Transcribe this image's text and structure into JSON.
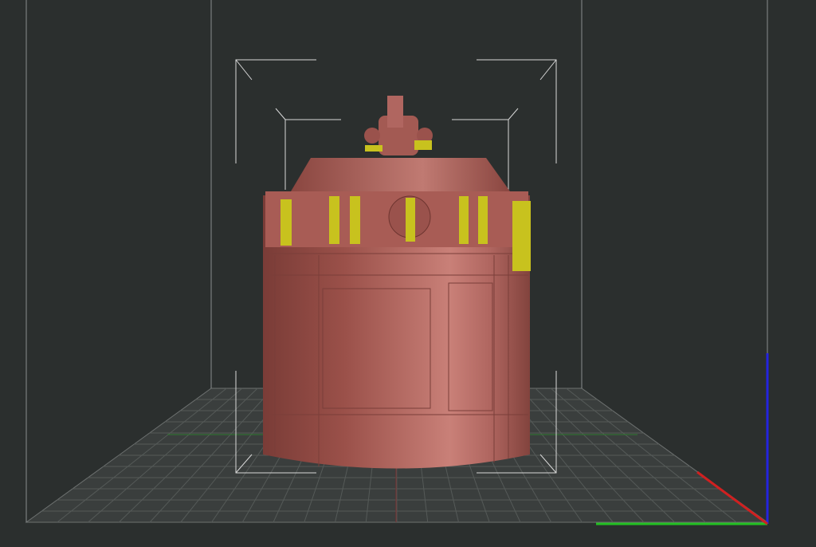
{
  "viewport": {
    "background": "#2b2f2e",
    "model_color": "#b5675f",
    "support_color": "#c8c21e",
    "axis_colors": {
      "x": "#d02020",
      "y": "#20c020",
      "z": "#2020e0"
    }
  }
}
